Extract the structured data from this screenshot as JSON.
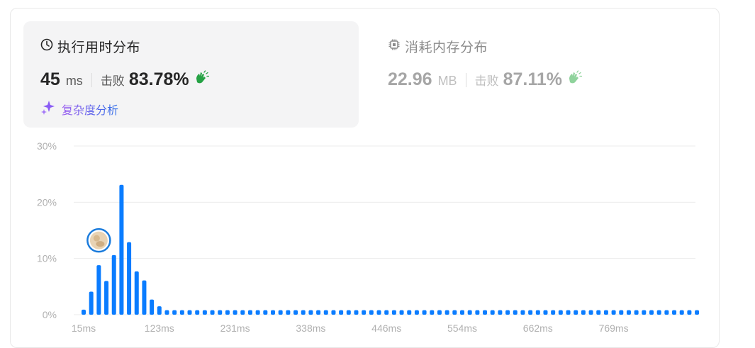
{
  "runtime": {
    "title": "执行用时分布",
    "value": "45",
    "unit": "ms",
    "beat_label": "击败",
    "beat_pct": "83.78%",
    "complexity_label": "复杂度分析"
  },
  "memory": {
    "title": "消耗内存分布",
    "value": "22.96",
    "unit": "MB",
    "beat_label": "击败",
    "beat_pct": "87.11%"
  },
  "colors": {
    "bar": "#0a7cff",
    "marker_ring": "#1a7bdc",
    "hand_active": "#25a244",
    "hand_inactive": "#8fd39c"
  },
  "chart_data": {
    "type": "bar",
    "ylim": [
      0,
      30
    ],
    "yticks": [
      "30%",
      "20%",
      "10%",
      "0%"
    ],
    "ytick_values": [
      30,
      20,
      10,
      0
    ],
    "xtick_labels": [
      "15ms",
      "123ms",
      "231ms",
      "338ms",
      "446ms",
      "554ms",
      "662ms",
      "769ms"
    ],
    "xtick_bar_index": [
      0,
      10,
      20,
      30,
      40,
      50,
      60,
      70
    ],
    "values": [
      0.9,
      4.1,
      8.8,
      6.0,
      10.6,
      23.1,
      12.9,
      7.7,
      6.1,
      2.7,
      1.5,
      0.8,
      0.8,
      0.8,
      0.8,
      0.8,
      0.8,
      0.8,
      0.8,
      0.8,
      0.8,
      0.8,
      0.8,
      0.8,
      0.8,
      0.8,
      0.8,
      0.8,
      0.8,
      0.8,
      0.8,
      0.8,
      0.8,
      0.8,
      0.8,
      0.8,
      0.8,
      0.8,
      0.8,
      0.8,
      0.8,
      0.8,
      0.8,
      0.8,
      0.8,
      0.8,
      0.8,
      0.8,
      0.8,
      0.8,
      0.8,
      0.8,
      0.8,
      0.8,
      0.8,
      0.8,
      0.8,
      0.8,
      0.8,
      0.8,
      0.8,
      0.8,
      0.8,
      0.8,
      0.8,
      0.8,
      0.8,
      0.8,
      0.8,
      0.8,
      0.8,
      0.8,
      0.8,
      0.8,
      0.8,
      0.8,
      0.8,
      0.8,
      0.8,
      0.8,
      0.8,
      0.8
    ],
    "marker_bar_index": 2,
    "grid": true
  }
}
